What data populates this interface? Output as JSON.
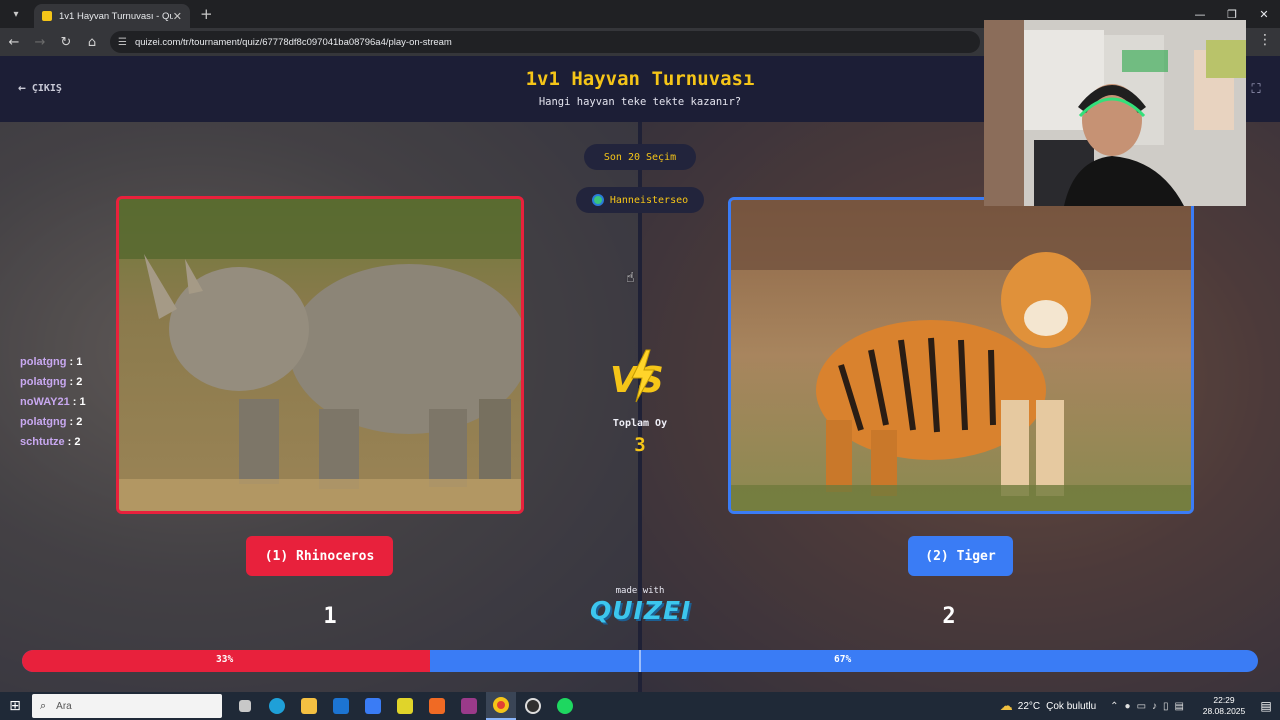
{
  "browser": {
    "tab_title": "1v1 Hayvan Turnuvası - Quizei",
    "url": "quizei.com/tr/tournament/quiz/67778df8c097041ba08796a4/play-on-stream"
  },
  "header": {
    "exit_label": "ÇIKIŞ",
    "title": "1v1 Hayvan Turnuvası",
    "subtitle": "Hangi hayvan teke tekte kazanır?"
  },
  "center": {
    "last_choices_label": "Son 20 Seçim",
    "username": "Hanneisterseo",
    "total_votes_label": "Toplam Oy",
    "total_votes": "3",
    "made_with_label": "made with",
    "brand": "QUIZEI"
  },
  "recent_votes": [
    {
      "name": "polatgng",
      "choice": "1"
    },
    {
      "name": "polatgng",
      "choice": "2"
    },
    {
      "name": "noWAY21",
      "choice": "1"
    },
    {
      "name": "polatgng",
      "choice": "2"
    },
    {
      "name": "schtutze",
      "choice": "2"
    }
  ],
  "choices": {
    "left": {
      "label": "(1) Rhinoceros",
      "votes": "1",
      "color": "#e8213c",
      "image": "rhinoceros"
    },
    "right": {
      "label": "(2) Tiger",
      "votes": "2",
      "color": "#3a7cf5",
      "image": "tiger"
    }
  },
  "progress": {
    "left_fraction": 0.33,
    "left_label": "33%",
    "right_label": "67%"
  },
  "taskbar": {
    "search_placeholder": "Ara",
    "weather_temp": "22°C",
    "weather_text": "Çok bulutlu",
    "time": "22:29",
    "date": "28.08.2025"
  },
  "colors": {
    "accent_yellow": "#f5c518",
    "brand_cyan": "#3cc6ee",
    "header_bg": "#1c1e36"
  }
}
